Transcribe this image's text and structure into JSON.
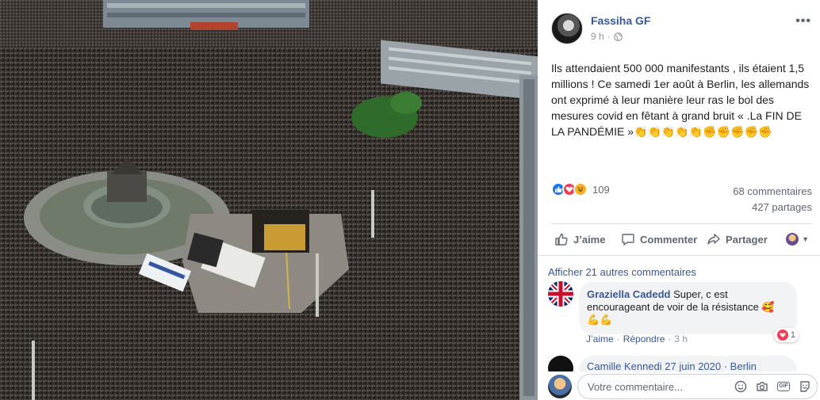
{
  "post": {
    "author": "Fassiha GF",
    "time": "9 h",
    "privacy_icon": "globe-icon",
    "text": "Ils attendaient 500 000 manifestants , ils étaient 1,5 millions ! Ce samedi 1er août à Berlin, les allemands ont exprimé à leur manière leur ras le bol des mesures covid en fêtant à grand bruit « .La FIN DE LA PANDÉMIE »",
    "trailing_emojis": [
      "👏",
      "👏",
      "👏",
      "👏",
      "👏",
      "✊",
      "✊",
      "✊",
      "✊",
      "✊"
    ],
    "reaction_icons": [
      "like-icon",
      "love-icon",
      "haha-icon"
    ],
    "reaction_count": "109",
    "comments_count": "68 commentaires",
    "shares_count": "427 partages"
  },
  "actions": {
    "like": "J’aime",
    "comment": "Commenter",
    "share": "Partager"
  },
  "comments": {
    "more_link": "Afficher 21 autres commentaires",
    "first": {
      "author": "Graziella Cadedd",
      "text": "Super, c est encourageant de voir de la résistance 🥰 💪💪",
      "reaction_count": "1",
      "like_label": "J’aime",
      "reply_label": "Répondre",
      "separator": "·",
      "time": "3 h"
    },
    "second_partial": "Camille Kennedi  27 juin 2020 · Berlin"
  },
  "composer": {
    "placeholder": "Votre commentaire...",
    "icons": [
      "emoji-icon",
      "camera-icon",
      "gif-icon",
      "sticker-icon"
    ],
    "gif_label": "GIF"
  },
  "colors": {
    "link_blue": "#385898",
    "like_blue": "#1877f2",
    "love_red": "#f33e58",
    "muted": "#606770"
  }
}
